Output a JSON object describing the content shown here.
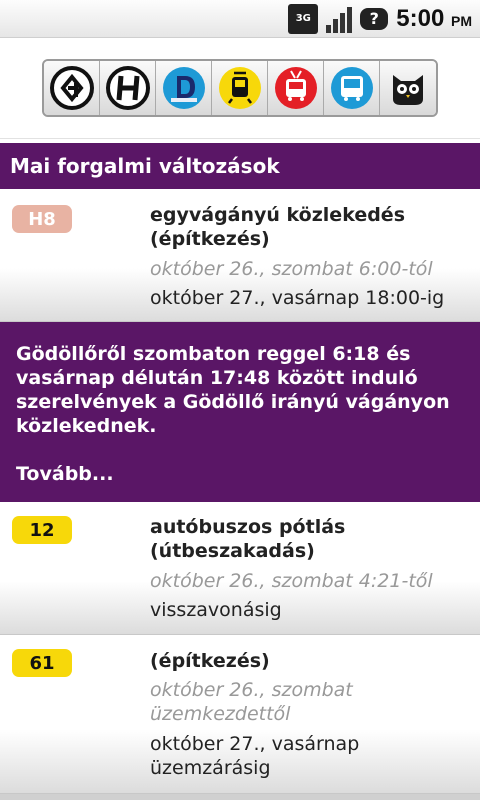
{
  "status_bar": {
    "network": "3G",
    "alert_icon": "?",
    "time": "5:00",
    "ampm": "PM"
  },
  "filters": [
    {
      "name": "hev-filter",
      "icon": "hev-logo-icon"
    },
    {
      "name": "ship-filter",
      "icon": "h-logo-icon"
    },
    {
      "name": "metro-filter",
      "icon": "metro-d-icon"
    },
    {
      "name": "tram-filter",
      "icon": "tram-icon"
    },
    {
      "name": "trolley-filter",
      "icon": "trolleybus-icon"
    },
    {
      "name": "bus-filter",
      "icon": "bus-icon"
    },
    {
      "name": "night-filter",
      "icon": "owl-icon"
    }
  ],
  "header": {
    "title": "Mai forgalmi változások"
  },
  "items": [
    {
      "badge": "H8",
      "title": "egyvágányú közlekedés (építkezés)",
      "from": "október 26., szombat  6:00-tól",
      "to": "október 27., vasárnap 18:00-ig"
    },
    {
      "badge": "12",
      "title": "autóbuszos pótlás (útbeszakadás)",
      "from": "október 26., szombat  4:21-től",
      "to": "visszavonásig"
    },
    {
      "badge": "61",
      "title": " (építkezés)",
      "from": "október 26., szombat üzemkezdettől",
      "to": "október 27., vasárnap üzemzárásig"
    }
  ],
  "message": {
    "text": "Gödöllőről szombaton reggel 6:18 és vasárnap délután 17:48 között induló szerelvények a Gödöllő irányú vágányon közlekednek.",
    "more": "Tovább..."
  },
  "colors": {
    "purple": "#5a1666",
    "hev_badge": "#e8b3a3",
    "bus_badge": "#f7d80a",
    "tram_yellow": "#f7d80a",
    "trolley_red": "#e41f26",
    "bus_blue": "#1e9ad6",
    "metro_blue": "#1e73c8"
  }
}
